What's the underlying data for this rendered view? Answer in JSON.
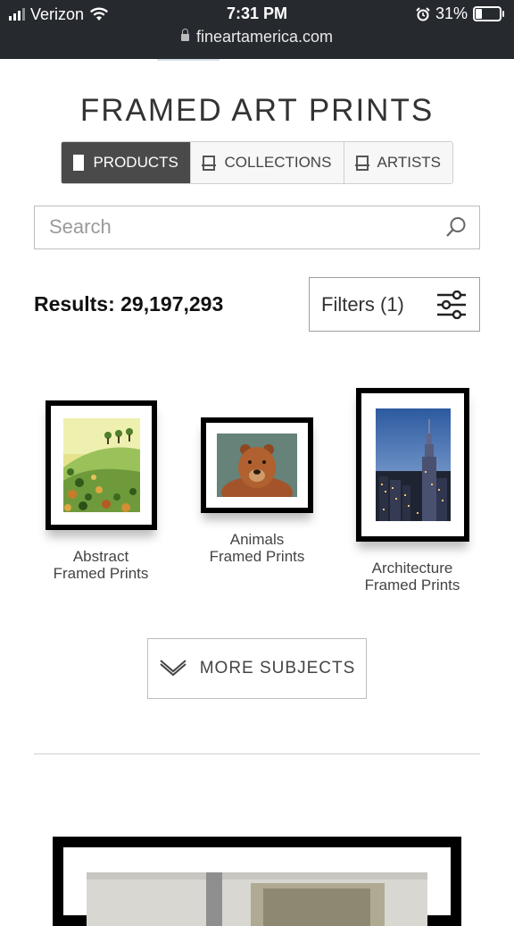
{
  "status_bar": {
    "carrier": "Verizon",
    "time": "7:31 PM",
    "battery_percent": "31%",
    "url": "fineartamerica.com"
  },
  "page": {
    "title": "FRAMED ART PRINTS"
  },
  "tabs": [
    {
      "label": "PRODUCTS",
      "icon": "document-icon",
      "active": true
    },
    {
      "label": "COLLECTIONS",
      "icon": "frame-icon",
      "active": false
    },
    {
      "label": "ARTISTS",
      "icon": "frame-icon",
      "active": false
    }
  ],
  "search": {
    "placeholder": "Search",
    "value": ""
  },
  "results": {
    "label": "Results: 29,197,293"
  },
  "filters": {
    "label": "Filters (1)",
    "icon": "sliders-icon"
  },
  "categories": [
    {
      "line1": "Abstract",
      "line2": "Framed Prints"
    },
    {
      "line1": "Animals",
      "line2": "Framed Prints"
    },
    {
      "line1": "Architecture",
      "line2": "Framed Prints"
    }
  ],
  "more_subjects": {
    "label": "MORE SUBJECTS",
    "icon": "chevron-down-icon"
  },
  "colors": {
    "status_bar_bg": "#26292e",
    "active_tab_bg": "#4a4a4a",
    "frame": "#000000"
  }
}
